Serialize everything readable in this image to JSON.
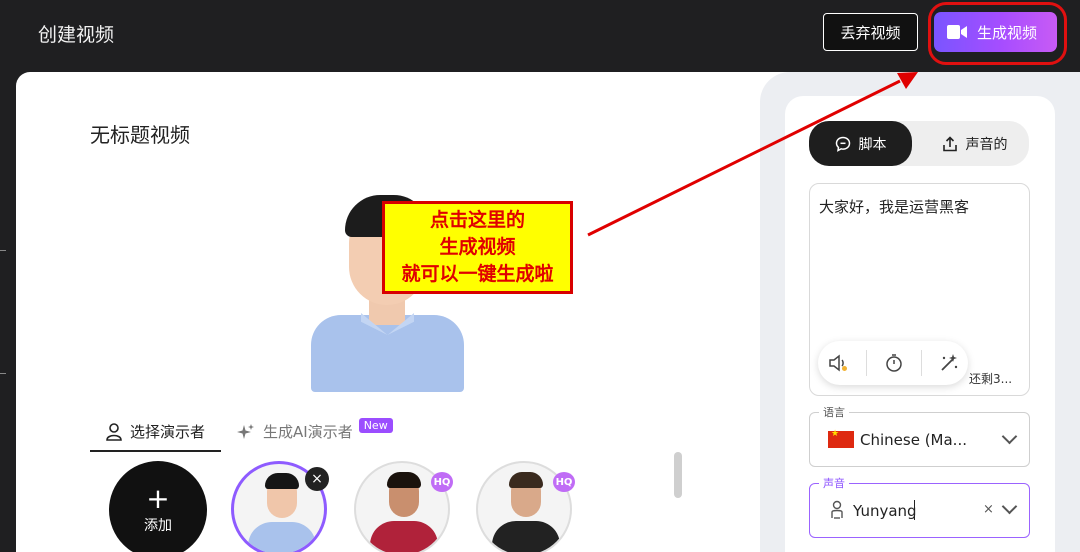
{
  "header": {
    "app_title": "创建视频",
    "discard_label": "丢弃视频",
    "generate_label": "生成视频"
  },
  "main": {
    "video_title": "无标题视频",
    "callout_lines": [
      "点击这里的",
      "生成视频",
      "就可以一键生成啦"
    ],
    "tabs": [
      {
        "label": "选择演示者",
        "active": true
      },
      {
        "label": "生成AI演示者",
        "badge": "New"
      }
    ],
    "add_label": "添加",
    "add_plus": "+",
    "hq_badge": "HQ",
    "close_symbol": "×"
  },
  "right_panel": {
    "tab_script": "脚本",
    "tab_audio": "声音的",
    "script_text": "大家好，我是运营黑客",
    "remaining": "还剩3...",
    "language_label": "语言",
    "language_value": "Chinese (Ma...",
    "voice_label": "声音",
    "voice_value": "Yunyang",
    "clear_symbol": "×"
  },
  "colors": {
    "accent_purple": "#9b4dff",
    "annotation_red": "#e00000",
    "callout_yellow": "#ffff00"
  }
}
